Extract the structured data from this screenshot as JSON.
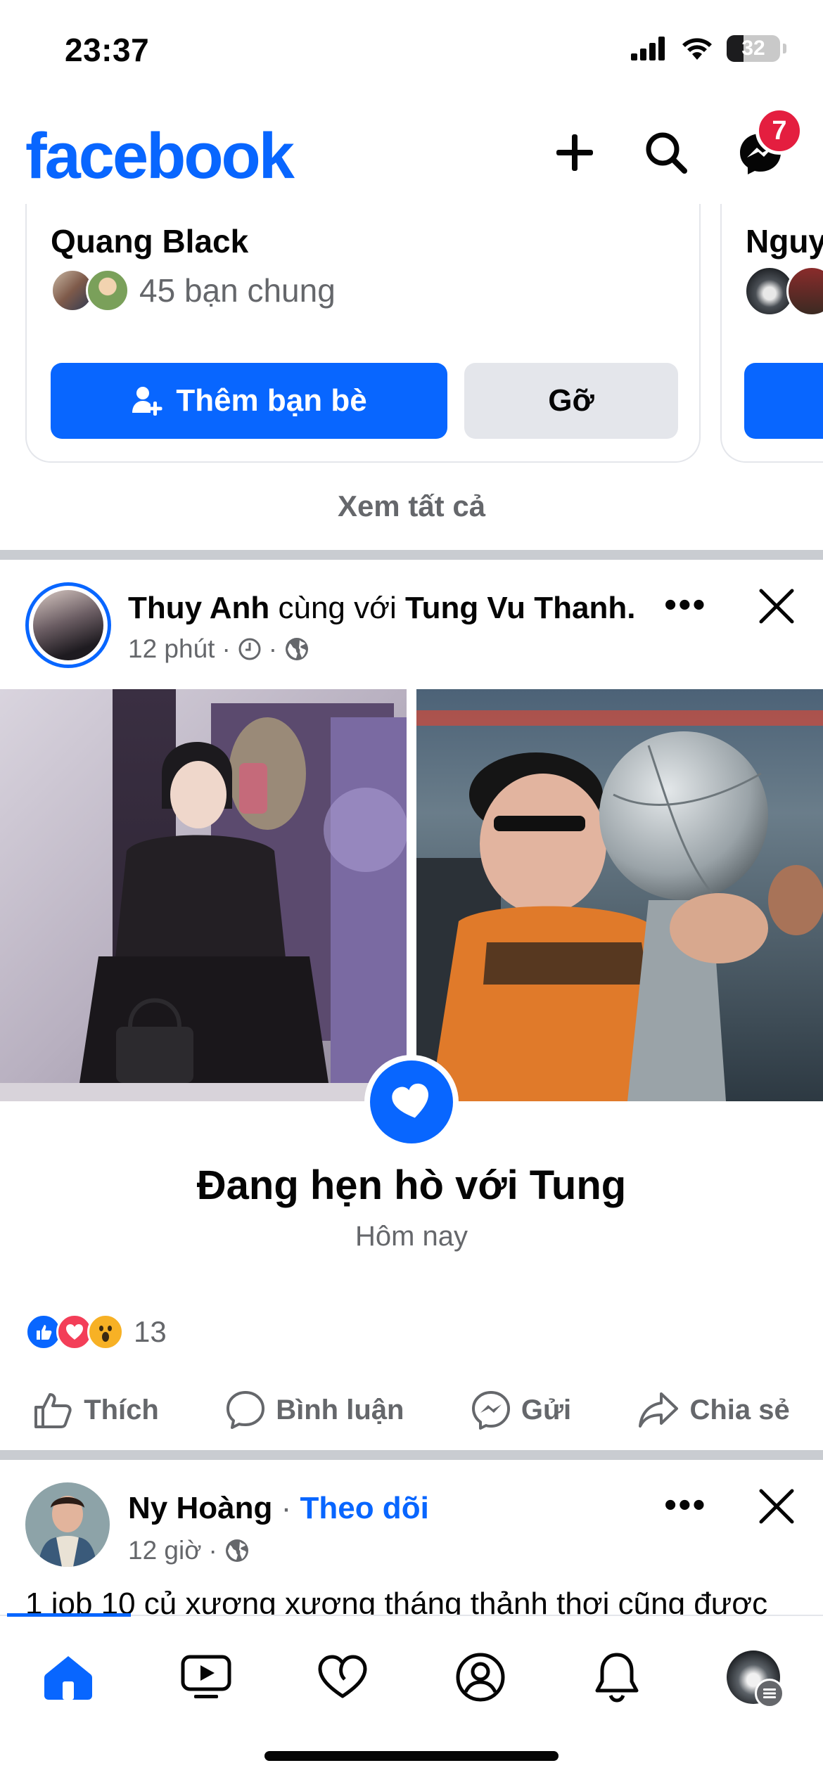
{
  "status_bar": {
    "time": "23:37",
    "battery": "32"
  },
  "header": {
    "logo": "facebook",
    "messenger_badge": "7",
    "icons": [
      "plus-icon",
      "search-icon",
      "messenger-icon"
    ]
  },
  "suggestion": {
    "name": "Quang Black",
    "mutual_friends": "45 bạn chung",
    "add_label": "Thêm bạn bè",
    "remove_label": "Gỡ",
    "next_name": "Nguy",
    "see_all": "Xem tất cả"
  },
  "post1": {
    "author": "Thuy Anh",
    "with_text": "cùng với",
    "tagged": "Tung Vu Thanh.",
    "time": "12 phút",
    "relationship": "Đang hẹn hò với Tung",
    "date": "Hôm nay",
    "reaction_count": "13",
    "actions": {
      "like": "Thích",
      "comment": "Bình luận",
      "send": "Gửi",
      "share": "Chia sẻ"
    }
  },
  "post2": {
    "author": "Ny Hoàng",
    "follow": "Theo dõi",
    "time": "12 giờ",
    "text": "1 job 10 củ xương xương tháng thảnh thơi cũng được"
  },
  "colors": {
    "brand": "#0866ff",
    "badge": "#e41e3f",
    "secondary_text": "#65676b",
    "separator": "#c9ccd1"
  }
}
